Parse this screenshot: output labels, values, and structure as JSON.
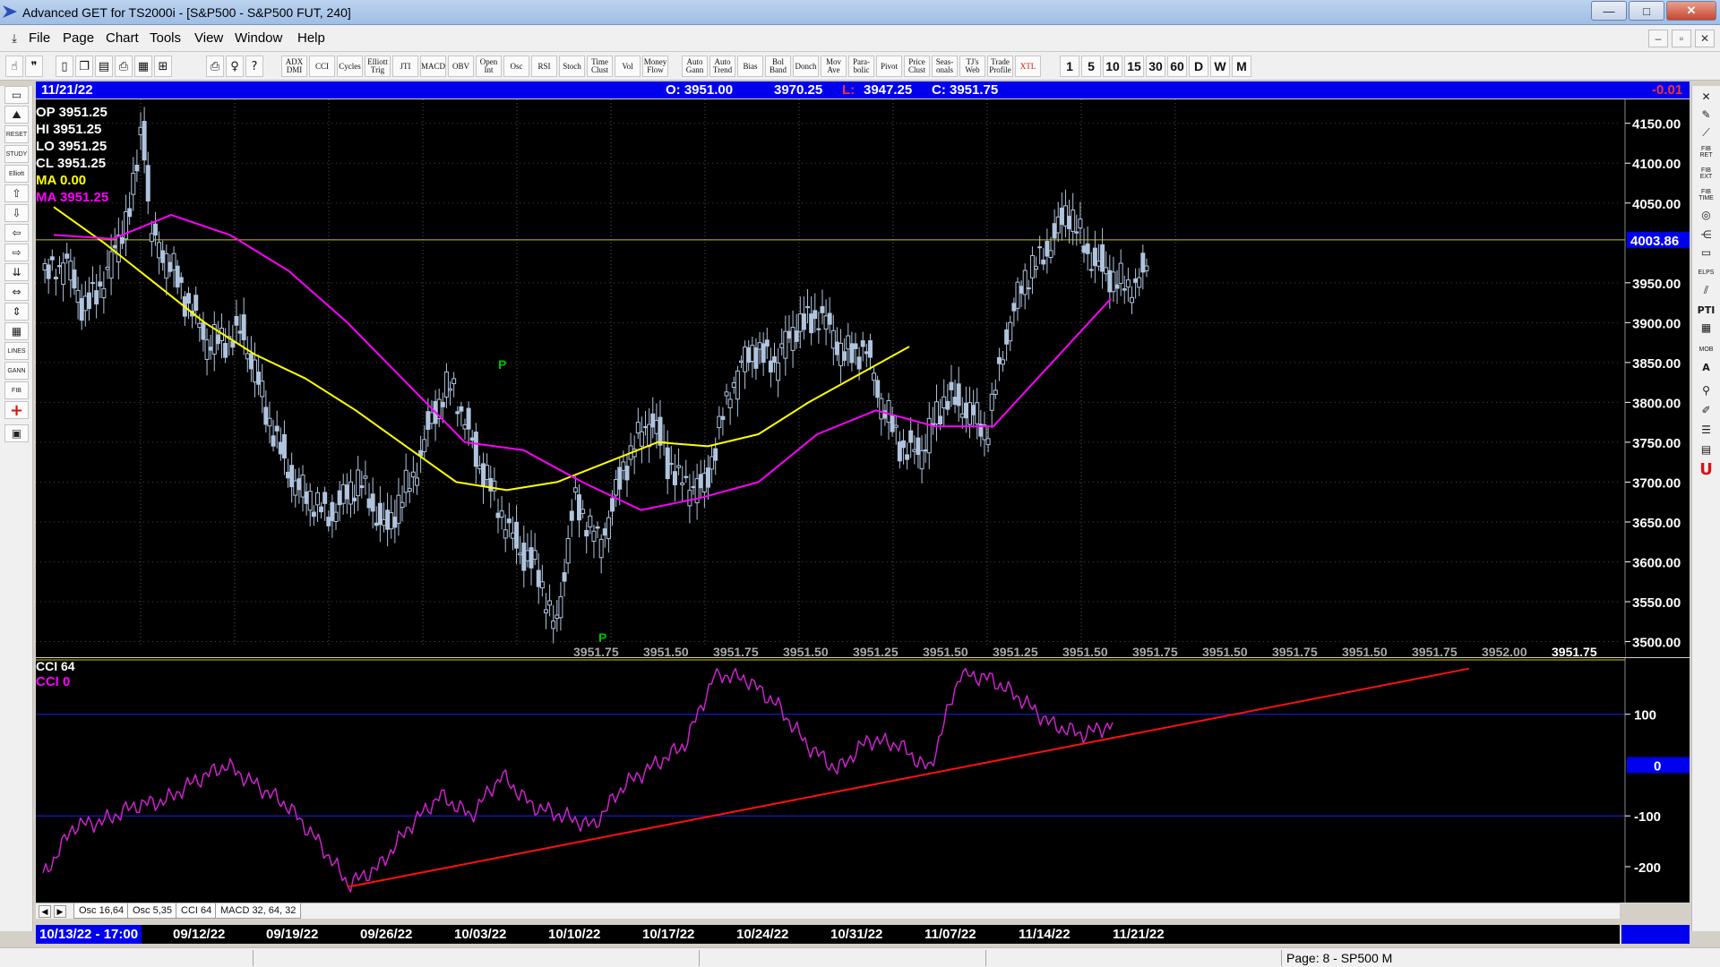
{
  "window": {
    "title": "Advanced GET for TS2000i - [S&P500 - S&P500 FUT, 240]",
    "minimize": "—",
    "maximize": "□",
    "close": "✕"
  },
  "menu": [
    "File",
    "Page",
    "Chart",
    "Tools",
    "View",
    "Window",
    "Help"
  ],
  "mdi_buttons": [
    "–",
    "▫",
    "✕"
  ],
  "toolbar": {
    "left_icons": [
      "hand-icon",
      "quote-icon",
      "new-page-icon",
      "copy-icon",
      "layout-icon",
      "print-preview-icon",
      "grid-icon",
      "zoom-fit-icon",
      "print-icon",
      "idea-icon",
      "help-icon"
    ],
    "indicators": [
      "ADX DMI",
      "CCI",
      "Cycles",
      "Elliott Trig",
      "JTI",
      "MACD",
      "OBV",
      "Open Int",
      "Osc",
      "RSI",
      "Stoch",
      "Time Clust",
      "Vol",
      "Money Flow",
      "Auto Gann",
      "Auto Trend",
      "Bias",
      "Bol Band",
      "Donch",
      "Mov Ave",
      "Para-bolic",
      "Pivot",
      "Price Clust",
      "Seas-onals",
      "TJ's Web",
      "Trade Profile",
      "XTL"
    ],
    "timeframes": [
      "1",
      "5",
      "10",
      "15",
      "30",
      "60",
      "D",
      "W",
      "M"
    ]
  },
  "infobar": {
    "date": "11/21/22",
    "open": "O: 3951.00",
    "high": "3970.25",
    "low_label": "L:",
    "low": "3947.25",
    "close": "C: 3951.75",
    "change": "-0.01"
  },
  "legend": {
    "op": "OP  3951.25",
    "hi": "HI   3951.25",
    "lo": "LO  3951.25",
    "cl": "CL   3951.25",
    "ma_yellow": "MA  0.00",
    "ma_magenta": "MA  3951.25"
  },
  "cci_legend": {
    "white": "CCI 64",
    "magenta": "CCI  0"
  },
  "colors": {
    "background": "#000000",
    "candle": "#b0c4de",
    "ma_yellow": "#ffff00",
    "ma_magenta": "#ff00ff",
    "cci_line": "#cc22cc",
    "trend_line": "#ff1010",
    "pivot_marker": "#00c000",
    "band_line": "#1e1ef0",
    "label_blue": "#0000ee"
  },
  "price_axis": {
    "ticks": [
      "4150.00",
      "4100.00",
      "4050.00",
      "4003.86",
      "3950.00",
      "3900.00",
      "3850.00",
      "3800.00",
      "3750.00",
      "3700.00",
      "3650.00",
      "3600.00",
      "3550.00",
      "3500.00"
    ],
    "current_price": "4003.86"
  },
  "bottom_readouts": [
    "3951.75",
    "3951.50",
    "3951.75",
    "3951.50",
    "3951.25",
    "3951.50",
    "3951.25",
    "3951.50",
    "3951.75",
    "3951.50",
    "3951.75",
    "3951.50",
    "3951.75",
    "3952.00",
    "3951.75"
  ],
  "pivot_markers": [
    "P",
    "P"
  ],
  "cci_axis": {
    "ticks": [
      "100",
      "0",
      "-100",
      "-200"
    ]
  },
  "tabs": [
    "Osc 16,64",
    "Osc 5,35",
    "CCI 64",
    "MACD 32, 64, 32"
  ],
  "dates": {
    "current": "10/13/22 - 17:00",
    "labels": [
      "09/12/22",
      "09/19/22",
      "09/26/22",
      "10/03/22",
      "10/10/22",
      "10/17/22",
      "10/24/22",
      "10/31/22",
      "11/07/22",
      "11/14/22",
      "11/21/22"
    ]
  },
  "status": {
    "page": "Page: 8 - SP500 M"
  },
  "chart_data": [
    {
      "type": "candlestick",
      "y_axis": [
        3500,
        4150
      ],
      "series": [
        {
          "name": "MA",
          "color": "#ffff00",
          "values": [
            4045,
            4000,
            3950,
            3900,
            3860,
            3830,
            3790,
            3745,
            3700,
            3690,
            3700,
            3725,
            3750,
            3745,
            3760,
            3800,
            3835,
            3870
          ]
        },
        {
          "name": "MA",
          "color": "#ff00ff",
          "values": [
            4010,
            4005,
            4035,
            4010,
            3965,
            3900,
            3825,
            3750,
            3740,
            3700,
            3665,
            3680,
            3700,
            3760,
            3790,
            3770,
            3770,
            3850,
            3930
          ]
        }
      ]
    },
    {
      "type": "line",
      "y_axis": [
        -260,
        200
      ],
      "series": [
        {
          "name": "CCI",
          "color": "#cc22cc",
          "values": [
            -220,
            -120,
            -110,
            -80,
            -70,
            -30,
            0,
            -40,
            -80,
            -150,
            -235,
            -200,
            -120,
            -60,
            -100,
            -20,
            -80,
            -100,
            -120,
            -40,
            0,
            40,
            180,
            170,
            120,
            40,
            -10,
            50,
            40,
            -10,
            180,
            170,
            130,
            80,
            60,
            80
          ]
        },
        {
          "name": "Trend",
          "color": "#ff1010",
          "values": [
            -240,
            190
          ]
        }
      ]
    }
  ]
}
